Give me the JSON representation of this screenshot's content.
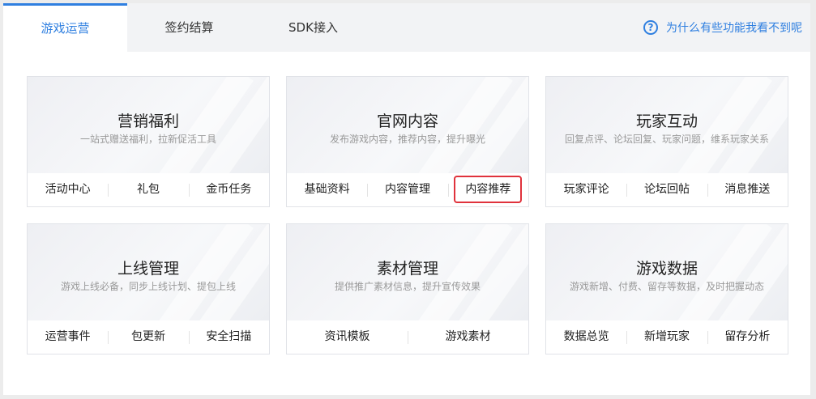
{
  "tabs": [
    {
      "label": "游戏运营",
      "active": true
    },
    {
      "label": "签约结算",
      "active": false
    },
    {
      "label": "SDK接入",
      "active": false
    }
  ],
  "help": {
    "icon": "question-circle-icon",
    "label": "为什么有些功能我看不到呢"
  },
  "accent_color": "#2f7fe0",
  "highlight_color": "#e0323c",
  "cards": [
    {
      "title": "营销福利",
      "subtitle": "一站式赠送福利，拉新促活工具",
      "links": [
        "活动中心",
        "礼包",
        "金币任务"
      ]
    },
    {
      "title": "官网内容",
      "subtitle": "发布游戏内容，推荐内容，提升曝光",
      "links": [
        "基础资料",
        "内容管理",
        "内容推荐"
      ]
    },
    {
      "title": "玩家互动",
      "subtitle": "回复点评、论坛回复、玩家问题，维系玩家关系",
      "links": [
        "玩家评论",
        "论坛回帖",
        "消息推送"
      ]
    },
    {
      "title": "上线管理",
      "subtitle": "游戏上线必备，同步上线计划、提包上线",
      "links": [
        "运营事件",
        "包更新",
        "安全扫描"
      ]
    },
    {
      "title": "素材管理",
      "subtitle": "提供推广素材信息，提升宣传效果",
      "links": [
        "资讯模板",
        "游戏素材"
      ]
    },
    {
      "title": "游戏数据",
      "subtitle": "游戏新增、付费、留存等数据，及时把握动态",
      "links": [
        "数据总览",
        "新增玩家",
        "留存分析"
      ]
    }
  ]
}
